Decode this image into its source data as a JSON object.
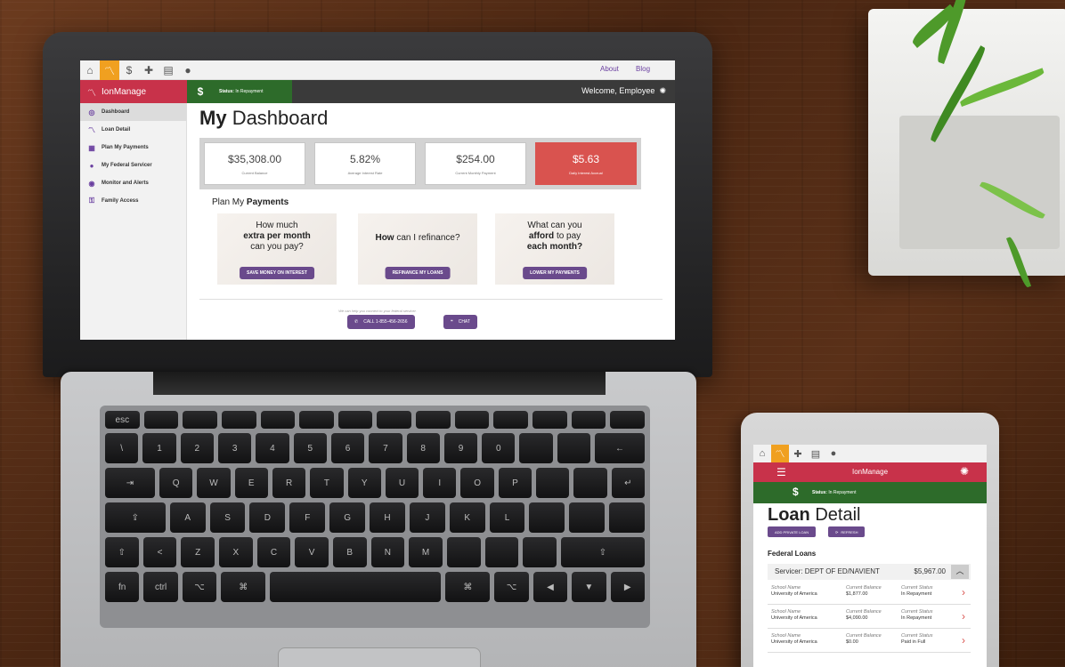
{
  "laptop": {
    "topbar": {
      "about": "About",
      "blog": "Blog"
    },
    "brand": "IonManage",
    "status": {
      "currency": "$",
      "label": "Status:",
      "value": "In Repayment"
    },
    "welcome": "Welcome, Employee",
    "sidebar": {
      "items": [
        {
          "label": "Dashboard",
          "icon": "dashboard-icon"
        },
        {
          "label": "Loan Detail",
          "icon": "pulse-icon"
        },
        {
          "label": "Plan My Payments",
          "icon": "calendar-icon"
        },
        {
          "label": "My Federal Servicer",
          "icon": "info-icon"
        },
        {
          "label": "Monitor and Alerts",
          "icon": "monitor-icon"
        },
        {
          "label": "Family Access",
          "icon": "key-icon"
        }
      ]
    },
    "main": {
      "title_bold": "My",
      "title_rest": "Dashboard",
      "stats": [
        {
          "value": "$35,308.00",
          "label": "Current Balance"
        },
        {
          "value": "5.82%",
          "label": "Average Interest Rate"
        },
        {
          "value": "$254.00",
          "label": "Current Monthly Payment"
        },
        {
          "value": "$5.63",
          "label": "Daily Interest Accrual"
        }
      ],
      "plan_title_plain": "Plan My",
      "plan_title_bold": "Payments",
      "cards": [
        {
          "l1": "How much",
          "l2": "extra per month",
          "l3": "can you pay?",
          "button": "SAVE MONEY ON INTEREST"
        },
        {
          "l1": "How",
          "l2": "can I refinance?",
          "button": "REFINANCE MY LOANS"
        },
        {
          "l1": "What can you",
          "l2a": "afford",
          "l2b": "to pay",
          "l3": "each month?",
          "button": "LOWER MY PAYMENTS"
        }
      ],
      "footer_note": "We can help you connect to your federal servicer.",
      "call": "CALL 1-855-456-2656",
      "chat": "CHAT"
    }
  },
  "tablet": {
    "brand": "IonManage",
    "status_label": "Status:",
    "status_value": "In Repayment",
    "currency": "$",
    "title_bold": "Loan",
    "title_rest": "Detail",
    "add_private": "ADD PRIVATE LOAN",
    "refresh": "REFRESH",
    "federal_loans": "Federal Loans",
    "servicer": "Servicer: DEPT OF ED/NAVIENT",
    "servicer_amount": "$5,967.00",
    "col_school": "School Name",
    "col_balance": "Current Balance",
    "col_status": "Current Status",
    "rows": [
      {
        "school": "University of America",
        "balance": "$1,877.00",
        "status": "In Repayment"
      },
      {
        "school": "University of America",
        "balance": "$4,090.00",
        "status": "In Repayment"
      },
      {
        "school": "University of America",
        "balance": "$0.00",
        "status": "Paid in Full"
      }
    ]
  },
  "colors": {
    "brand_red": "#c8324a",
    "status_green": "#2d6b2a",
    "button_purple": "#6a4a8c",
    "accent_orange": "#f0a020",
    "alert_red": "#d9534f"
  }
}
